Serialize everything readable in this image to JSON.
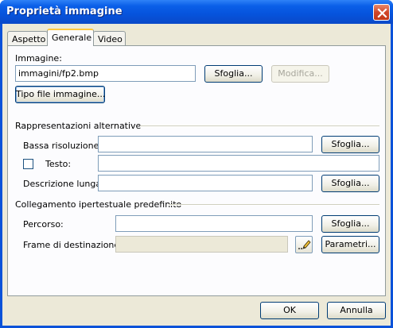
{
  "window": {
    "title": "Proprietà immagine",
    "close_icon": "close-icon"
  },
  "tabs": [
    {
      "label": "Aspetto",
      "active": false
    },
    {
      "label": "Generale",
      "active": true
    },
    {
      "label": "Video",
      "active": false
    }
  ],
  "image": {
    "label": "Immagine:",
    "value": "immagini/fp2.bmp",
    "browse_label": "Sfoglia...",
    "edit_label": "Modifica...",
    "file_type_label": "Tipo file immagine..."
  },
  "alternatives": {
    "heading": "Rappresentazioni alternative",
    "low_res_label": "Bassa risoluzione:",
    "low_res_value": "",
    "low_res_browse": "Sfoglia...",
    "text_label": "Testo:",
    "text_checked": false,
    "text_value": "",
    "long_desc_label": "Descrizione lunga:",
    "long_desc_value": "",
    "long_desc_browse": "Sfoglia..."
  },
  "hyperlink": {
    "heading": "Collegamento ipertestuale predefinito",
    "path_label": "Percorso:",
    "path_value": "",
    "path_browse": "Sfoglia...",
    "target_label": "Frame di destinazione:",
    "target_value": "",
    "edit_icon": "pencil-icon",
    "params_label": "Parametri..."
  },
  "footer": {
    "ok_label": "OK",
    "cancel_label": "Annulla"
  }
}
